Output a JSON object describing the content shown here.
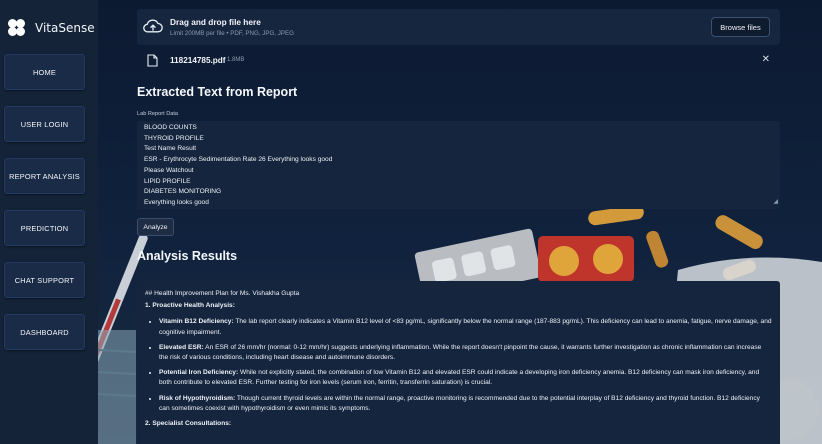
{
  "app": {
    "name": "VitaSense"
  },
  "sidebar": {
    "items": [
      {
        "label": "HOME"
      },
      {
        "label": "USER LOGIN"
      },
      {
        "label": "REPORT ANALYSIS"
      },
      {
        "label": "PREDICTION"
      },
      {
        "label": "CHAT SUPPORT"
      },
      {
        "label": "DASHBOARD"
      }
    ]
  },
  "uploader": {
    "title": "Drag and drop file here",
    "subtitle": "Limit 200MB per file • PDF, PNG, JPG, JPEG",
    "browse_label": "Browse files",
    "icon": "cloud-upload-icon"
  },
  "file": {
    "name": "118214785.pdf",
    "size": "1.8MB",
    "close": "✕"
  },
  "extracted": {
    "heading": "Extracted Text from Report",
    "label": "Lab Report Data",
    "lines": [
      "BLOOD COUNTS",
      "THYROID PROFILE",
      "Test Name Result",
      "ESR - Erythrocyte Sedimentation Rate 26 Everything looks good",
      "Please Watchout",
      "LIPID PROFILE",
      "DIABETES MONITORING",
      "Everything looks good"
    ],
    "analyze_label": "Analyze"
  },
  "results": {
    "heading": "Analysis Results",
    "plan_title": "## Health Improvement Plan for Ms. Vishakha Gupta",
    "section1": "1. Proactive Health Analysis:",
    "bullets": [
      {
        "term": "Vitamin B12 Deficiency:",
        "text": " The lab report clearly indicates a Vitamin B12 level of <83 pg/mL, significantly below the normal range (187-883 pg/mL). This deficiency can lead to anemia, fatigue, nerve damage, and cognitive impairment."
      },
      {
        "term": "Elevated ESR:",
        "text": " An ESR of 26 mm/hr (normal: 0-12 mm/hr) suggests underlying inflammation. While the report doesn't pinpoint the cause, it warrants further investigation as chronic inflammation can increase the risk of various conditions, including heart disease and autoimmune disorders."
      },
      {
        "term": "Potential Iron Deficiency:",
        "text": " While not explicitly stated, the combination of low Vitamin B12 and elevated ESR could indicate a developing iron deficiency anemia. B12 deficiency can mask iron deficiency, and both contribute to elevated ESR. Further testing for iron levels (serum iron, ferritin, transferrin saturation) is crucial."
      },
      {
        "term": "Risk of Hypothyroidism:",
        "text": " Though current thyroid levels are within the normal range, proactive monitoring is recommended due to the potential interplay of B12 deficiency and thyroid function. B12 deficiency can sometimes coexist with hypothyroidism or even mimic its symptoms."
      }
    ],
    "section2": "2. Specialist Consultations:"
  }
}
